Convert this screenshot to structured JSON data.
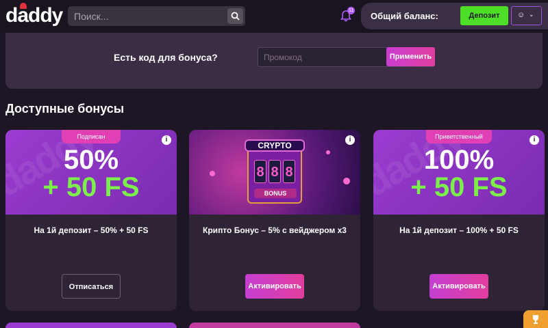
{
  "header": {
    "logo_text": "daddy",
    "search_placeholder": "Поиск...",
    "notification_count": "11",
    "balance_label": "Общий баланс:",
    "deposit_label": "Депозит"
  },
  "promo": {
    "question": "Есть код для бонуса?",
    "input_placeholder": "Промокод",
    "apply_label": "Применить"
  },
  "section_title": "Доступные бонусы",
  "cards": [
    {
      "tag": "Подписан",
      "line1": "50%",
      "line2": "+ 50 FS",
      "title": "На 1й депозит – 50% + 50 FS",
      "action": "Отписаться"
    },
    {
      "banner_text": "CRYPTO",
      "banner_bonus": "BONUS",
      "title": "Крипто Бонус – 5% с вейджером х3",
      "action": "Активировать"
    },
    {
      "tag": "Приветственный",
      "line1": "100%",
      "line2": "+ 50 FS",
      "title": "На 1й депозит – 100% + 50 FS",
      "action": "Активировать"
    }
  ],
  "colors": {
    "accent_green": "#4ddf28",
    "accent_pink": "#e040b3",
    "bonus_green": "#7cf04a"
  }
}
